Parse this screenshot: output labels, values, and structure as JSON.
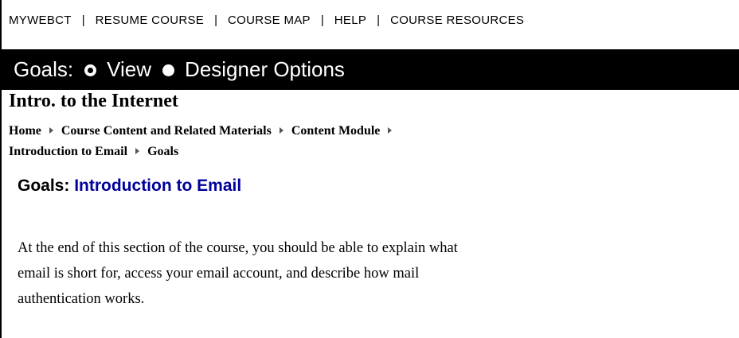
{
  "top_nav": {
    "items": [
      "MYWEBCT",
      "RESUME COURSE",
      "COURSE MAP",
      "HELP",
      "COURSE RESOURCES"
    ],
    "separator": "|"
  },
  "goals_bar": {
    "label": "Goals:",
    "options": [
      {
        "label": "View",
        "selected": true
      },
      {
        "label": "Designer Options",
        "selected": false
      }
    ]
  },
  "course": {
    "title": "Intro. to the Internet"
  },
  "breadcrumb": {
    "items": [
      "Home",
      "Course Content and Related Materials",
      "Content Module",
      "Introduction to Email",
      "Goals"
    ]
  },
  "content": {
    "heading_prefix": "Goals:",
    "heading_topic": "Introduction to Email",
    "body_lines": [
      "At the end of this section of the course, you should be able to explain what",
      "email is short for, access your email account, and describe how mail",
      "authentication works."
    ]
  },
  "colors": {
    "bar_background": "#000000",
    "heading_topic": "#00009c"
  }
}
